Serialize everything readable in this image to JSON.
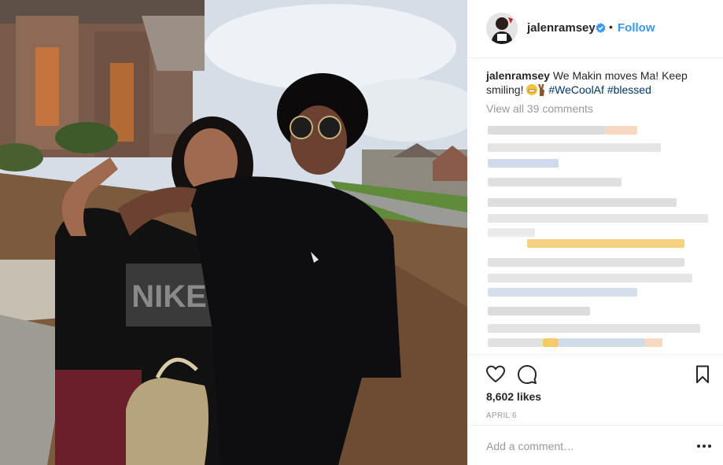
{
  "post": {
    "username": "jalenramsey",
    "follow_label": "Follow",
    "separator": "•",
    "caption": {
      "username": "jalenramsey",
      "text": " We Makin moves Ma! Keep smiling! ",
      "hashtag_1": "#WeCoolAf",
      "hashtag_2": "#blessed"
    },
    "view_all_comments": "View all 39 comments",
    "likes": "8,602 likes",
    "date": "April 6",
    "comment_placeholder": "Add a comment…"
  },
  "icons": {
    "verified": "verified-badge-icon",
    "like": "heart-icon",
    "comment": "comment-bubble-icon",
    "save": "bookmark-icon",
    "more": "more-options-icon"
  },
  "colors": {
    "accent": "#3897f0",
    "hashtag": "#003569",
    "muted": "#999999",
    "text": "#262626",
    "divider": "#efefef"
  }
}
